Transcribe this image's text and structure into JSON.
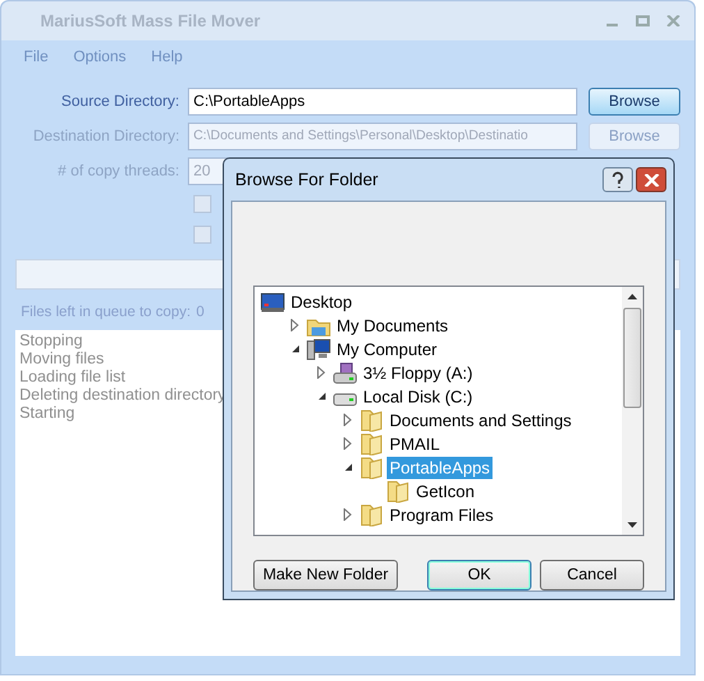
{
  "window": {
    "title": "MariusSoft Mass File Mover"
  },
  "menu": [
    "File",
    "Options",
    "Help"
  ],
  "source": {
    "label": "Source Directory:",
    "value": "C:\\PortableApps",
    "button": "Browse"
  },
  "destination": {
    "label": "Destination Directory:",
    "value": "C:\\Documents and Settings\\Personal\\Desktop\\Destinatio",
    "button": "Browse"
  },
  "threads": {
    "label": "# of copy threads:",
    "value": "20"
  },
  "options": [
    {
      "checked": false
    },
    {
      "checked": false
    }
  ],
  "progress": {
    "level": 0
  },
  "queue": {
    "label": "Files left in queue to copy:",
    "value": "0"
  },
  "log": [
    "Stopping",
    "Moving files",
    "Loading file list",
    "Deleting destination directory",
    "Starting"
  ],
  "dialog": {
    "title": "Browse For Folder",
    "buttons": [
      "Make New Folder",
      "OK",
      "Cancel"
    ],
    "tree": [
      {
        "label": "Desktop",
        "kind": "desktop",
        "selected": false,
        "children": [
          {
            "label": "My Documents",
            "kind": "documents",
            "selected": false,
            "expanded": false
          },
          {
            "label": "My Computer",
            "kind": "computer",
            "selected": false,
            "expanded": true,
            "children": [
              {
                "label": "3½ Floppy (A:)",
                "kind": "floppy",
                "selected": false,
                "expanded": false
              },
              {
                "label": "Local Disk (C:)",
                "kind": "disk",
                "selected": false,
                "expanded": true,
                "children": [
                  {
                    "label": "Documents and Settings",
                    "kind": "folder",
                    "selected": false,
                    "expanded": false
                  },
                  {
                    "label": "PMAIL",
                    "kind": "folder",
                    "selected": false,
                    "expanded": false
                  },
                  {
                    "label": "PortableApps",
                    "kind": "folder",
                    "selected": true,
                    "expanded": true,
                    "children": [
                      {
                        "label": "GetIcon",
                        "kind": "folder",
                        "selected": false
                      }
                    ]
                  },
                  {
                    "label": "Program Files",
                    "kind": "folder",
                    "selected": false,
                    "expanded": false
                  }
                ]
              }
            ]
          }
        ]
      }
    ]
  }
}
